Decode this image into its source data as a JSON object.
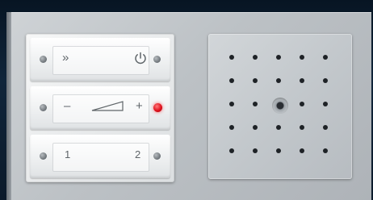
{
  "switch_panel": {
    "row1": {
      "left_glyph": "»",
      "right_icon": "power-icon"
    },
    "row2": {
      "left_glyph": "–",
      "right_glyph": "+",
      "led_color": "#e0101c"
    },
    "row3": {
      "left_label": "1",
      "right_label": "2"
    }
  },
  "speaker_panel": {
    "grille_rows": 5,
    "grille_cols": 5,
    "center": "microphone"
  },
  "colors": {
    "frame": "#c4c8cc",
    "background": "#0d1c2d",
    "led": "#e0101c"
  }
}
